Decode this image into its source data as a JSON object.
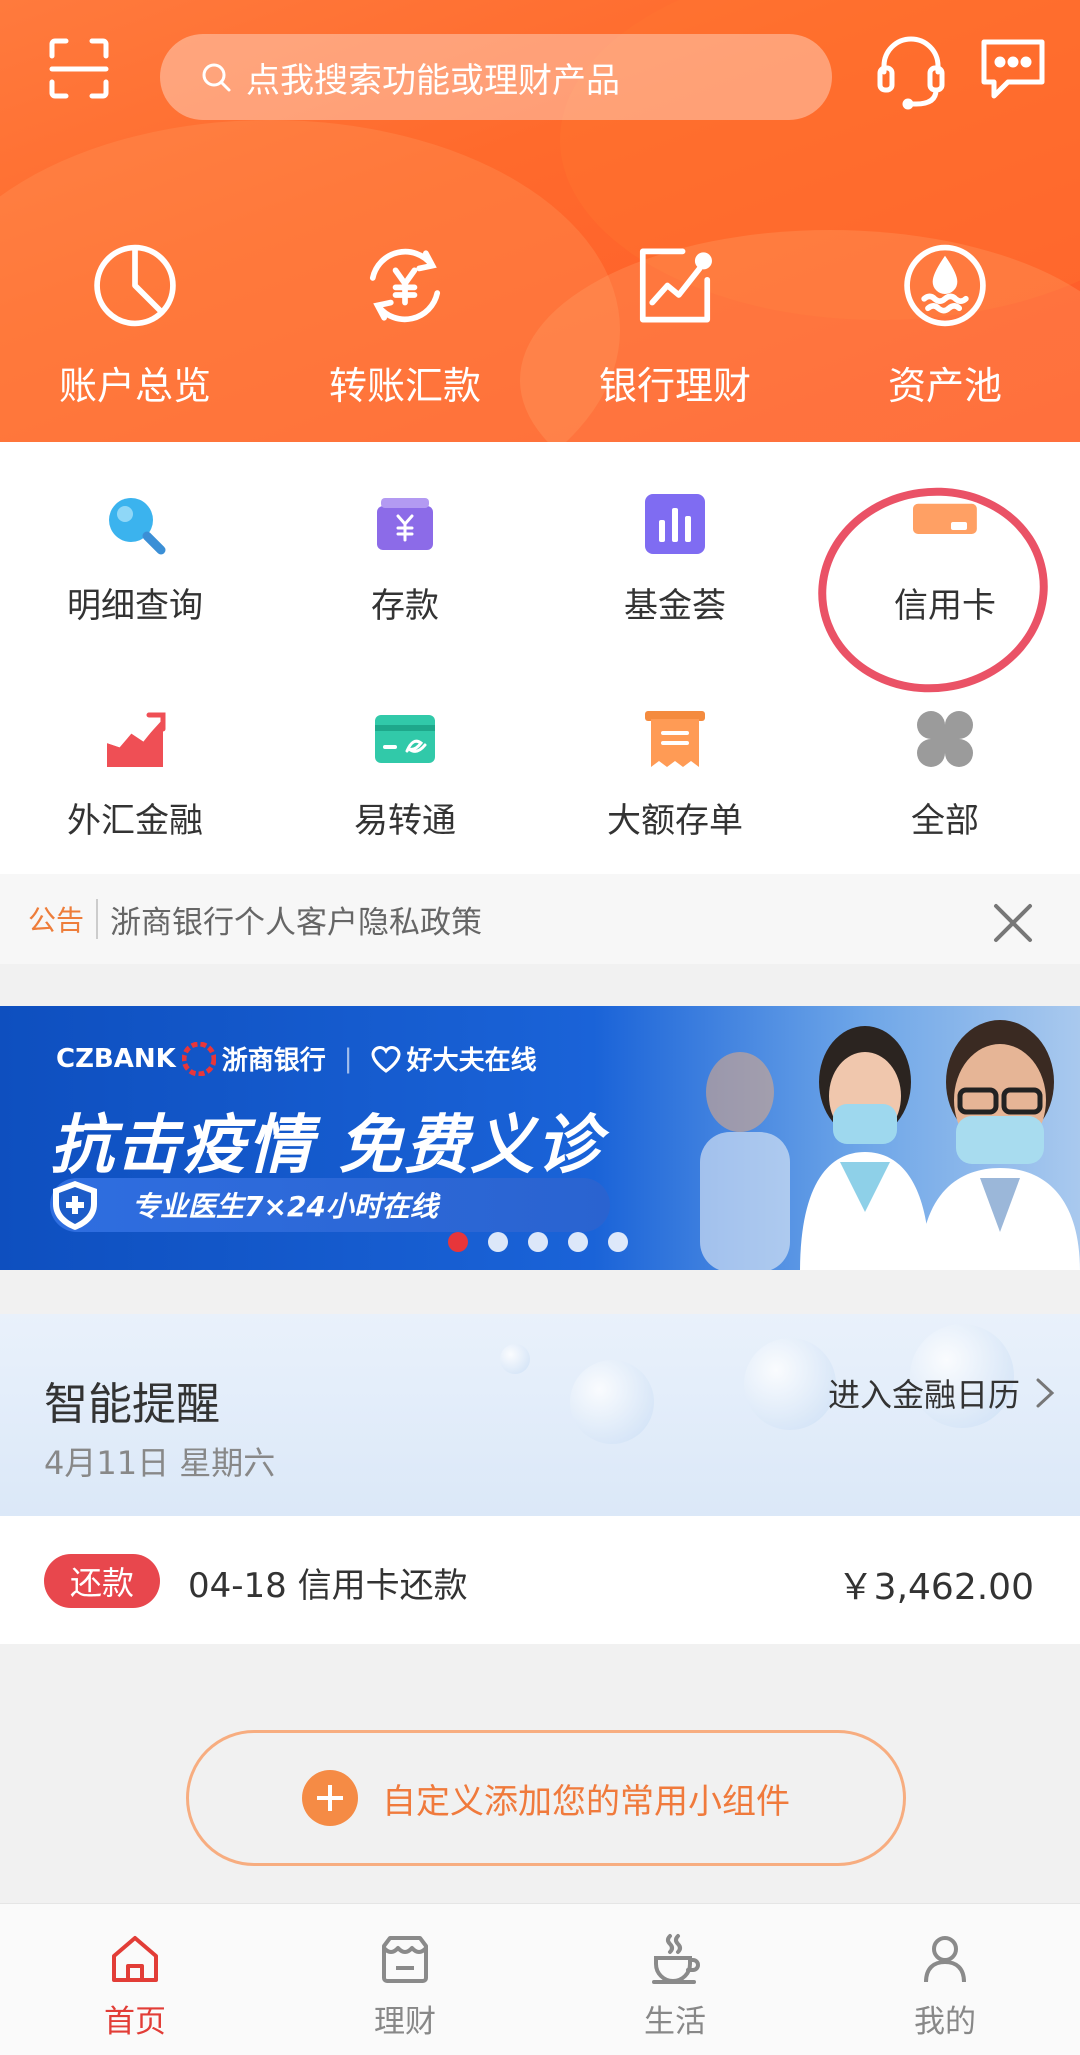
{
  "header": {
    "search_placeholder": "点我搜索功能或理财产品",
    "quick_actions": [
      {
        "label": "账户总览",
        "icon": "pie-chart-icon"
      },
      {
        "label": "转账汇款",
        "icon": "yuan-transfer-icon"
      },
      {
        "label": "银行理财",
        "icon": "trend-chart-icon"
      },
      {
        "label": "资产池",
        "icon": "water-drop-icon"
      }
    ]
  },
  "grid": {
    "row1": [
      {
        "label": "明细查询",
        "icon": "magnifier-icon"
      },
      {
        "label": "存款",
        "icon": "deposit-icon"
      },
      {
        "label": "基金荟",
        "icon": "bar-chart-icon"
      },
      {
        "label": "信用卡",
        "icon": "credit-card-icon"
      }
    ],
    "row2": [
      {
        "label": "外汇金融",
        "icon": "forex-icon"
      },
      {
        "label": "易转通",
        "icon": "easy-transfer-icon"
      },
      {
        "label": "大额存单",
        "icon": "certificate-icon"
      },
      {
        "label": "全部",
        "icon": "all-apps-icon"
      }
    ]
  },
  "notice": {
    "tag": "公告",
    "text": "浙商银行个人客户隐私政策"
  },
  "banner": {
    "brand": "CZBANK",
    "brand_cn": "浙商银行",
    "partner": "好大夫在线",
    "headline": "抗击疫情 免费义诊",
    "subline": "专业医生7×24小时在线",
    "dots_total": 5,
    "active_dot": 1
  },
  "reminder": {
    "title": "智能提醒",
    "date": "4月11日 星期六",
    "link": "进入金融日历",
    "item": {
      "badge": "还款",
      "desc": "04-18 信用卡还款",
      "amount": "￥3,462.00"
    }
  },
  "add_widget": {
    "label": "自定义添加您的常用小组件"
  },
  "tabbar": {
    "tabs": [
      {
        "label": "首页",
        "icon": "home-icon",
        "active": true
      },
      {
        "label": "理财",
        "icon": "wealth-icon",
        "active": false
      },
      {
        "label": "生活",
        "icon": "coffee-cup-icon",
        "active": false
      },
      {
        "label": "我的",
        "icon": "user-icon",
        "active": false
      }
    ]
  },
  "colors": {
    "brand_orange": "#ff6a2c",
    "active_red": "#e23d37",
    "badge_red": "#e8474d",
    "highlight_circle": "#ea5266"
  }
}
